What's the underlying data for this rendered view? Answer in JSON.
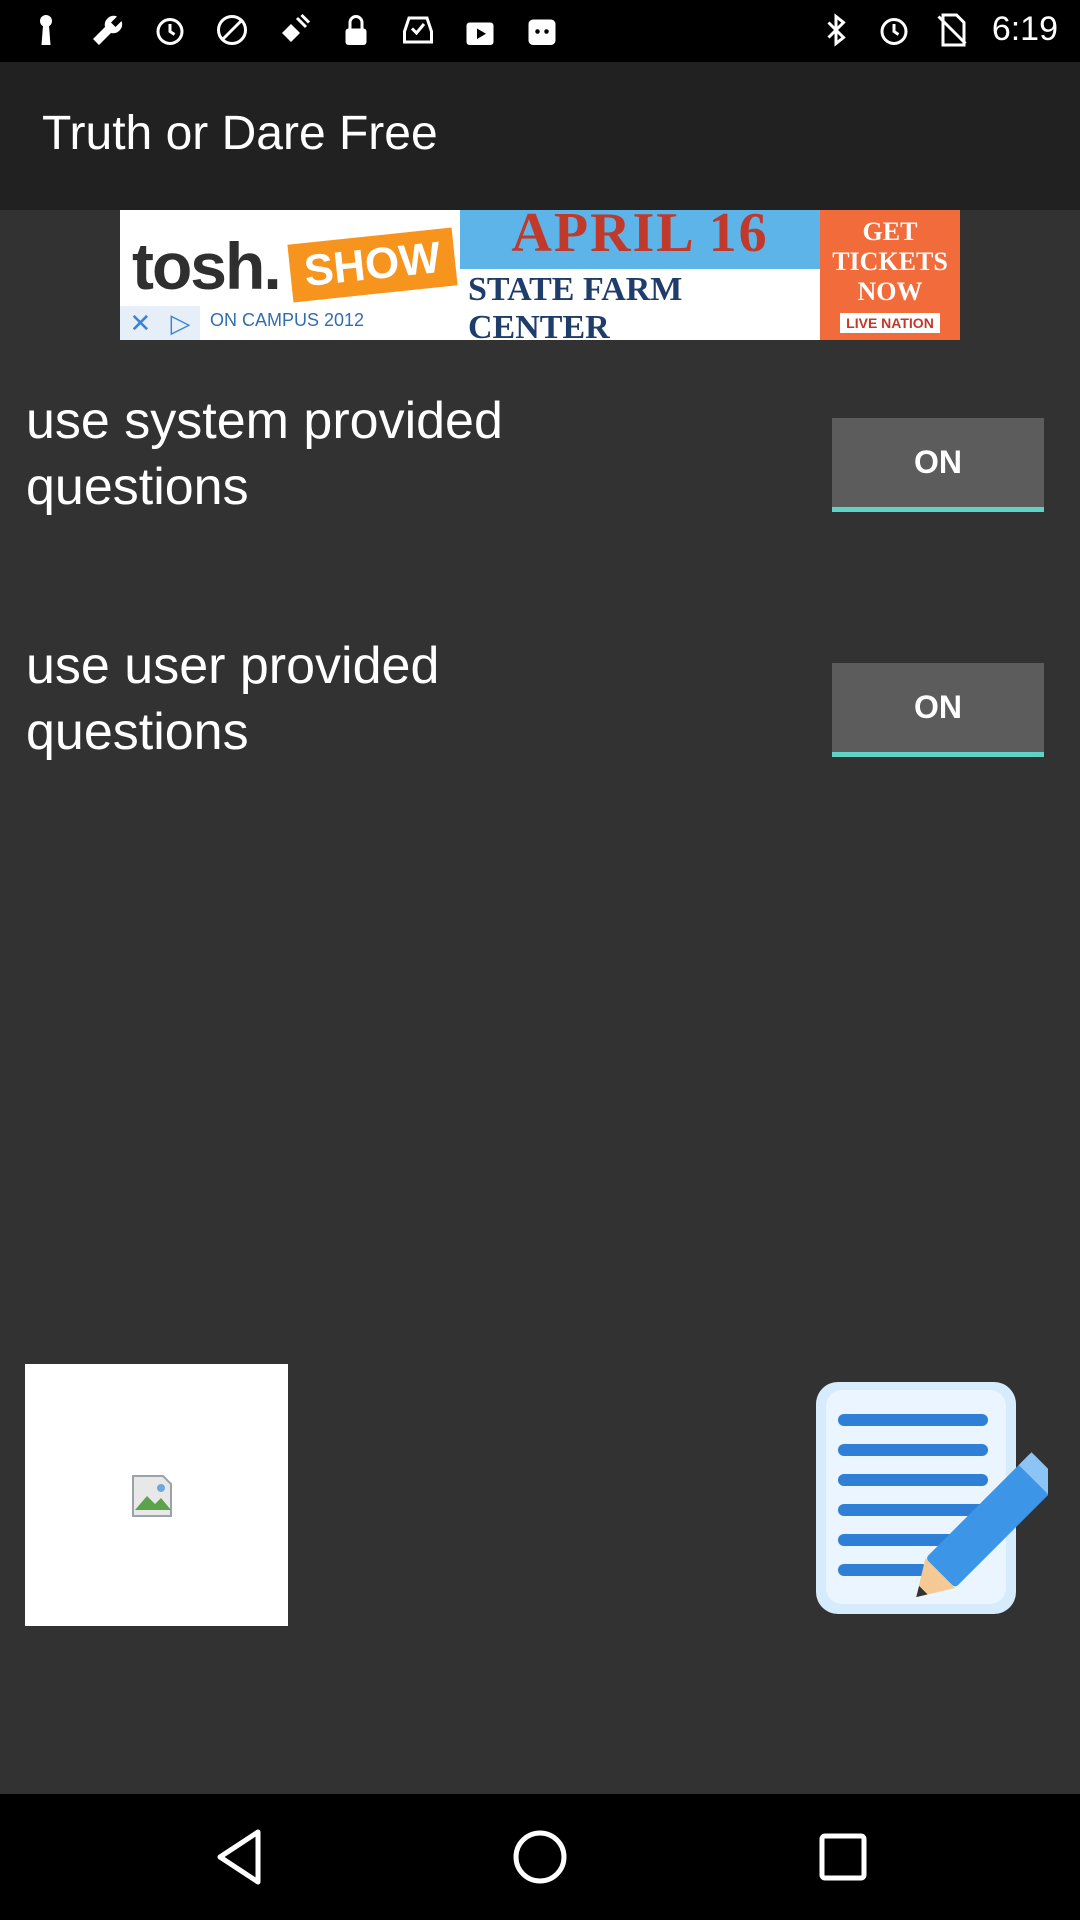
{
  "status_bar": {
    "time": "6:19",
    "left_icons": [
      "keyhole-icon",
      "wrench-icon",
      "alarm-icon",
      "no-signal-icon",
      "satellite-icon",
      "lock-icon",
      "inbox-check-icon",
      "play-bag-icon",
      "android-bag-icon"
    ],
    "right_icons": [
      "bluetooth-icon",
      "alarm-icon",
      "no-sim-icon"
    ]
  },
  "app_bar": {
    "title": "Truth or Dare Free"
  },
  "ad_banner": {
    "brand": "tosh.",
    "show": "SHOW",
    "small_text": "ON CAMPUS 2012",
    "date": "APRIL 16",
    "venue": "STATE FARM CENTER",
    "cta": "GET TICKETS NOW",
    "sponsor": "LIVE NATION"
  },
  "settings": [
    {
      "label": "use system provided questions",
      "toggle": "ON"
    },
    {
      "label": "use user provided questions",
      "toggle": "ON"
    }
  ],
  "colors": {
    "background": "#323232",
    "app_bar": "#212121",
    "toggle_bg": "#5c5c5c",
    "toggle_accent": "#5fd3c5"
  }
}
